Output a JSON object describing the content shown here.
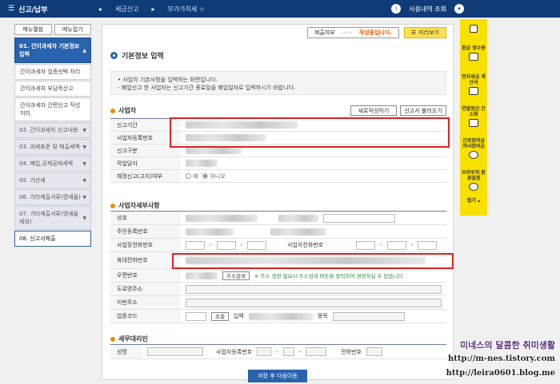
{
  "topbar": {
    "menu_label": "신고/납부",
    "crumb1": "세금신고",
    "crumb2": "부가가치세",
    "user_label": "사용내역 조회"
  },
  "sidebar": {
    "tab_expand": "메뉴펼침",
    "tab_collapse": "메뉴접기",
    "items": [
      {
        "label": "01. 간이과세자 기본정보 입력",
        "type": "active"
      },
      {
        "label": "간이과세자 업종선택 처리",
        "type": "sub"
      },
      {
        "label": "간이과세자 부담목산고",
        "type": "sub"
      },
      {
        "label": "간이과세자 간편신고 작성 처리",
        "type": "sub"
      },
      {
        "label": "02. 간이과세자 신고내용",
        "type": "normal"
      },
      {
        "label": "03. 과세표준 및 매출세액",
        "type": "normal"
      },
      {
        "label": "04. 매입,공제공제세액",
        "type": "normal"
      },
      {
        "label": "05. 가산세",
        "type": "normal"
      },
      {
        "label": "06. 기타제출서류(영세율)",
        "type": "normal"
      },
      {
        "label": "07. 기타제출서류(영세율 제외)",
        "type": "normal"
      },
      {
        "label": "08. 신고서제출",
        "type": "final"
      }
    ]
  },
  "status": {
    "submitted": "제출여부",
    "arrows": "›››››",
    "state": "작성중입니다.",
    "preview": "미리보기"
  },
  "page": {
    "title": "기본정보 입력",
    "info_line1": "• 사업자 기본사항을 입력하는 화면입니다.",
    "info_line2": "- 폐업신고 한 사업자는 신고기간 종료일을 폐업일자로 입력하시기 바랍니다."
  },
  "section1": {
    "title": "사업자",
    "btn_new": "새로작성하기",
    "btn_load": "신고서 불러오기",
    "rows": {
      "period": "신고기간",
      "bizno": "사업자등록번호",
      "type": "신고구분",
      "owner": "작업담자",
      "correction": "해정신고(고지)여부"
    },
    "yes": "예",
    "no": "아니오"
  },
  "section2": {
    "title": "사업자세부사항",
    "rows": {
      "name": "상호",
      "resident": "주민등록번호",
      "bizphone": "사업장전화번호",
      "bizphone2": "사업자전화번호",
      "mobile": "휴대전화번호",
      "zip": "우편번호",
      "road": "도로명주소",
      "lot": "지번주소",
      "code": "업종코드"
    },
    "addr_btn": "주소검색",
    "addr_note": "※ 주소 경정 필요시 주소검색 버튼을 클릭하여 경정하실 수 있습니다.",
    "lookup_btn": "조회",
    "input_label": "입력",
    "item_label": "종목"
  },
  "section3": {
    "title": "세무대리인",
    "name": "성명",
    "bizno": "사업자등록번호",
    "phone": "전화번호"
  },
  "save_button": "저장 후 다음이동",
  "rightbar": {
    "items": [
      "환급 영수증",
      "전자세금 계산서",
      "연말정산 간소화",
      "근로장려금 자녀장려금",
      "브라우저 환경설정"
    ],
    "close": "접기"
  },
  "watermark": {
    "line1": "미네스의 달콤한 취미생활",
    "line2": "http://m-nes.tistory.com",
    "line3": "http://leira0601.blog.me"
  }
}
